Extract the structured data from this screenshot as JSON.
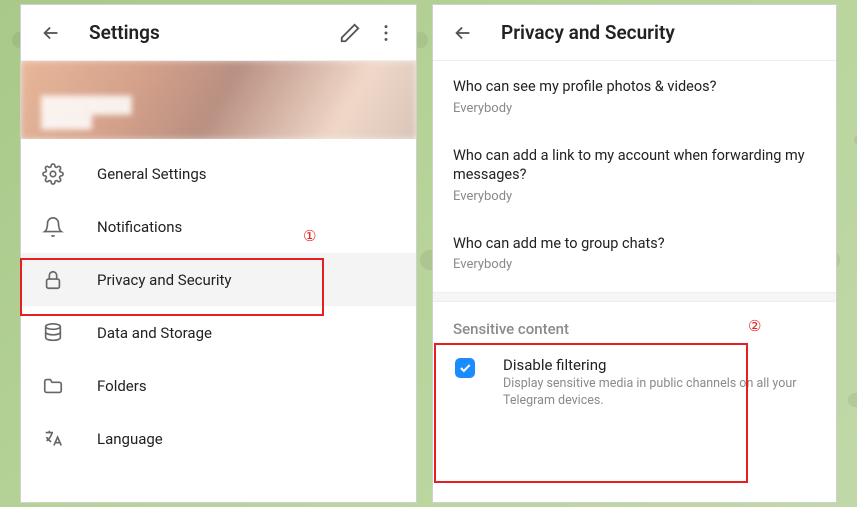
{
  "settings": {
    "title": "Settings",
    "items": [
      {
        "label": "General Settings"
      },
      {
        "label": "Notifications"
      },
      {
        "label": "Privacy and Security"
      },
      {
        "label": "Data and Storage"
      },
      {
        "label": "Folders"
      },
      {
        "label": "Language"
      }
    ]
  },
  "privacy": {
    "title": "Privacy and Security",
    "items": [
      {
        "question": "Who can see my profile photos & videos?",
        "answer": "Everybody"
      },
      {
        "question": "Who can add a link to my account when forwarding my messages?",
        "answer": "Everybody"
      },
      {
        "question": "Who can add me to group chats?",
        "answer": "Everybody"
      }
    ],
    "sensitive": {
      "header": "Sensitive content",
      "option_title": "Disable filtering",
      "option_desc": "Display sensitive media in public channels on all your Telegram devices.",
      "checked": true
    }
  },
  "annotations": {
    "one": "①",
    "two": "②"
  }
}
